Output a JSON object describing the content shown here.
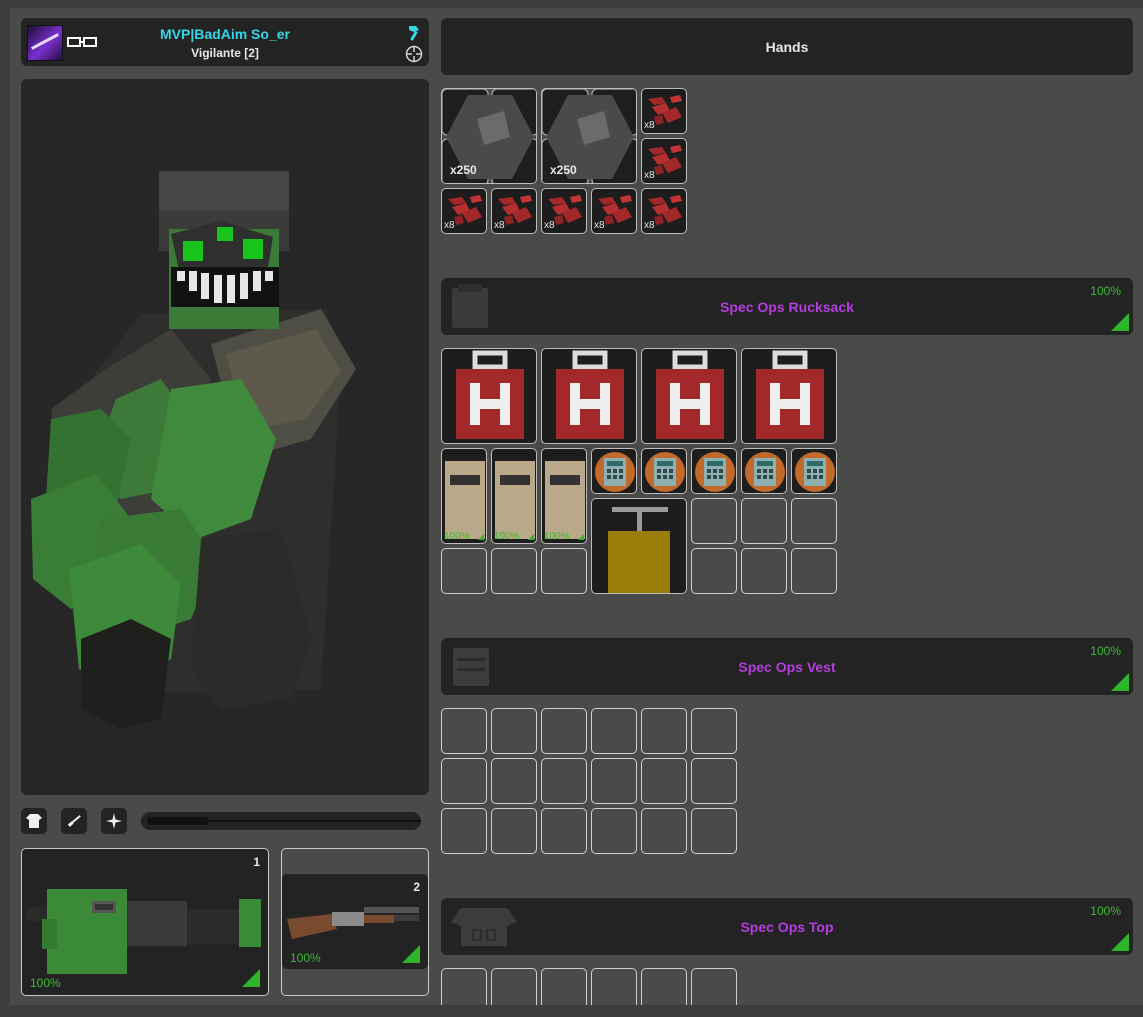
{
  "player": {
    "name": "MVP|BadAim So_er",
    "rank": "Vigilante [2]"
  },
  "hands": {
    "label": "Hands"
  },
  "toolbar": {
    "icons": [
      "shirt-icon",
      "rifle-icon",
      "sparkle-icon"
    ],
    "zoom_level": 0.22
  },
  "weapons": [
    {
      "slot": "1",
      "durability": "100%"
    },
    {
      "slot": "2",
      "durability": "100%"
    }
  ],
  "hands_items": {
    "rocks": [
      {
        "qty": "x250"
      },
      {
        "qty": "x250"
      }
    ],
    "ammo": [
      "x8",
      "x8",
      "x8",
      "x8",
      "x8",
      "x8",
      "x8"
    ]
  },
  "rucksack": {
    "name": "Spec Ops Rucksack",
    "durability": "100%",
    "name_color": "#b43ee0",
    "medkits": 4,
    "armor_plates": [
      "100%",
      "100%",
      "100%"
    ],
    "detonators": 5
  },
  "vest": {
    "name": "Spec Ops Vest",
    "durability": "100%"
  },
  "top": {
    "name": "Spec Ops Top",
    "durability": "100%"
  },
  "colors": {
    "accent": "#35d7e6",
    "quality": "#3bbd2e",
    "item_name": "#b43ee0"
  }
}
